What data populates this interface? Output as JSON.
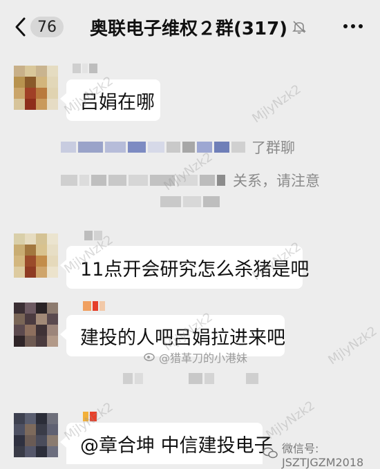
{
  "header": {
    "unread_count": "76",
    "group_title": "奥联电子维权２群(317)"
  },
  "messages": [
    {
      "text": "吕娟在哪"
    },
    {
      "text": "11点开会研究怎么杀猪是吧"
    },
    {
      "text": "建投的人吧吕娟拉进来吧"
    },
    {
      "text": "@章合坤 中信建投电子"
    }
  ],
  "system_notice": {
    "line1_visible": "了群聊",
    "line2_visible": "关系，请注意"
  },
  "watermarks": {
    "diagonal": "MjlyNzk2",
    "weibo": "@猎革刀的小港妹",
    "weixin": "微信号: JSZTJGZM2018"
  },
  "colors": {
    "background": "#ededed",
    "bubble": "#ffffff",
    "badge": "#d7d7d7"
  },
  "icons": [
    "chevron-left-icon",
    "mute-bell-icon",
    "more-dots-icon",
    "weibo-icon",
    "wechat-icon"
  ]
}
